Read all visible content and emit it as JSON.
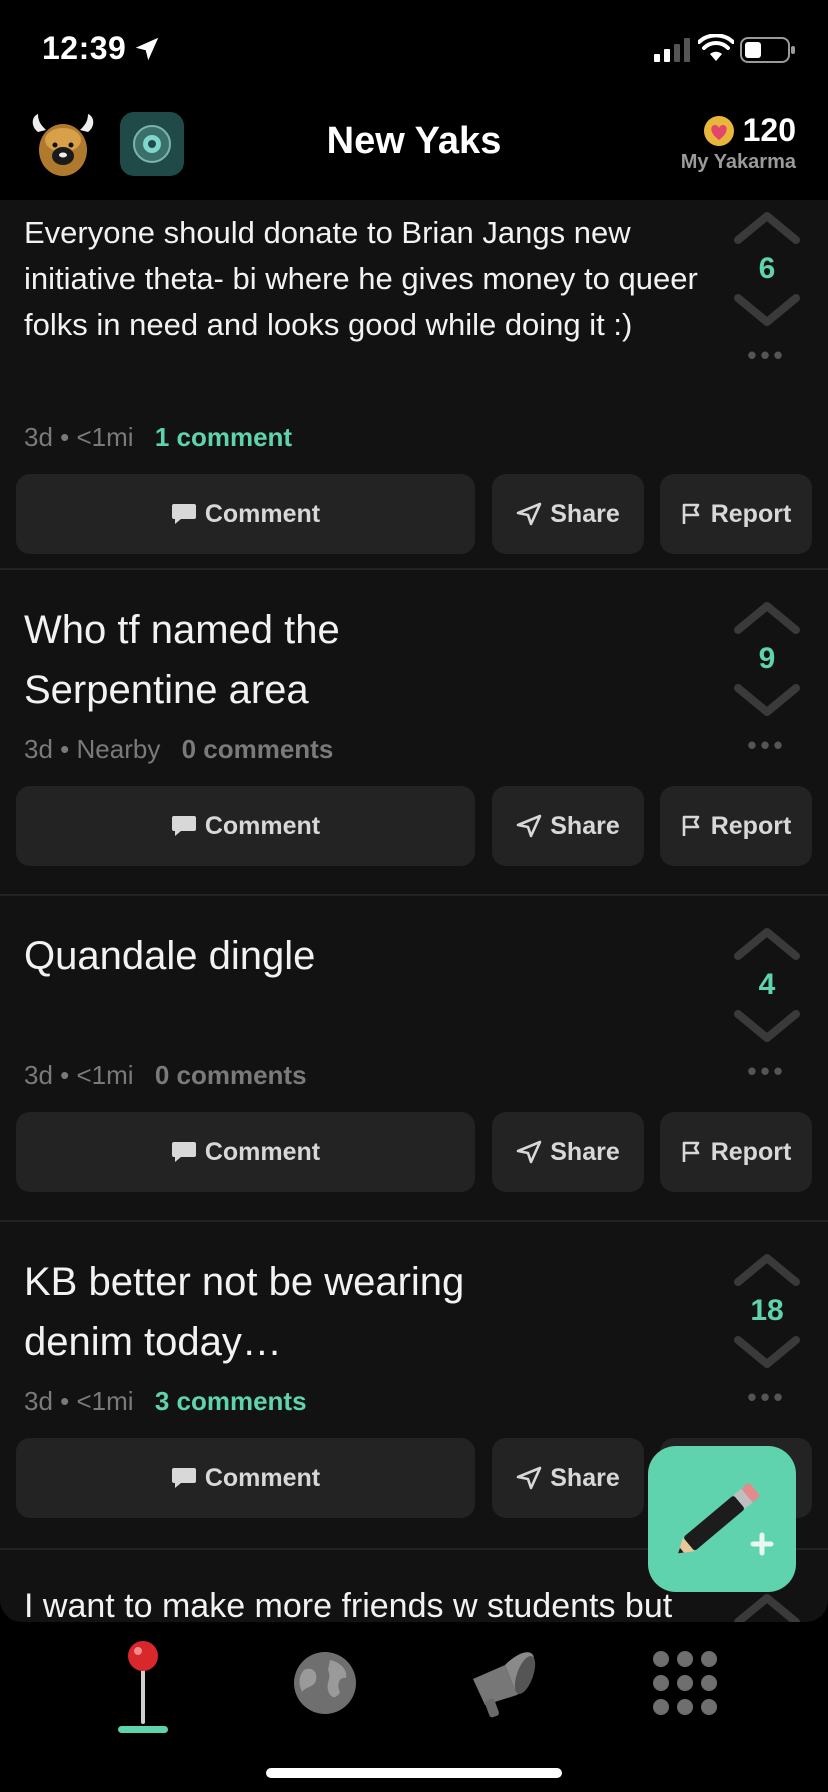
{
  "status": {
    "time": "12:39"
  },
  "header": {
    "title": "New Yaks",
    "yakarma_count": "120",
    "yakarma_label": "My Yakarma"
  },
  "posts": [
    {
      "text": "Everyone should donate to Brian Jangs new initiative theta- bi where he gives money to queer folks in need and looks good while doing it :)",
      "age": "3d",
      "distance": "<1mi",
      "comments": "1 comment",
      "votes": "6"
    },
    {
      "text": "Who tf named the Serpentine area",
      "age": "3d",
      "distance": "Nearby",
      "comments": "0 comments",
      "votes": "9"
    },
    {
      "text": "Quandale dingle",
      "age": "3d",
      "distance": "<1mi",
      "comments": "0 comments",
      "votes": "4"
    },
    {
      "text": "KB better not be wearing denim today…",
      "age": "3d",
      "distance": "<1mi",
      "comments": "3 comments",
      "votes": "18"
    },
    {
      "text": "I want to make more friends w students but"
    }
  ],
  "actions": {
    "comment": "Comment",
    "share": "Share",
    "report": "Report"
  },
  "meta_separator": "•",
  "icons": {
    "tabs": [
      "pin-icon",
      "globe-icon",
      "megaphone-icon",
      "grid-icon"
    ],
    "fab": "compose-pencil-icon"
  },
  "colors": {
    "accent": "#5fd3ad",
    "background": "#121212",
    "button": "#232323"
  }
}
